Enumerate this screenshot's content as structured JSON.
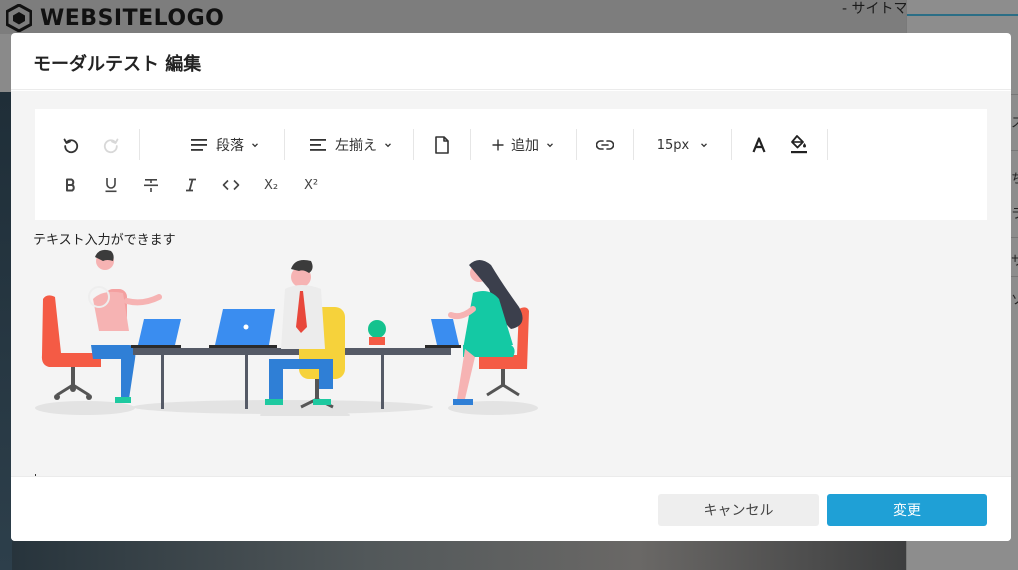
{
  "background": {
    "logo_text": "WEBSITELOGO",
    "sitemap_label": "- サイトマ",
    "right_peek": [
      "ス",
      "ち",
      "ラ",
      "サ",
      "ソ"
    ]
  },
  "modal": {
    "title": "モーダルテスト 編集",
    "toolbar": {
      "paragraph_label": "段落",
      "align_label": "左揃え",
      "add_label": "追加",
      "font_size": "15px",
      "subscript_label": "X₂",
      "superscript_label": "X²"
    },
    "editor": {
      "text": "テキスト入力ができます",
      "image_icon": "office-meeting-illustration"
    },
    "footer": {
      "cancel_label": "キャンセル",
      "ok_label": "変更"
    }
  },
  "colors": {
    "accent": "#1fa0d6",
    "overlay": "#8a8a8a"
  }
}
